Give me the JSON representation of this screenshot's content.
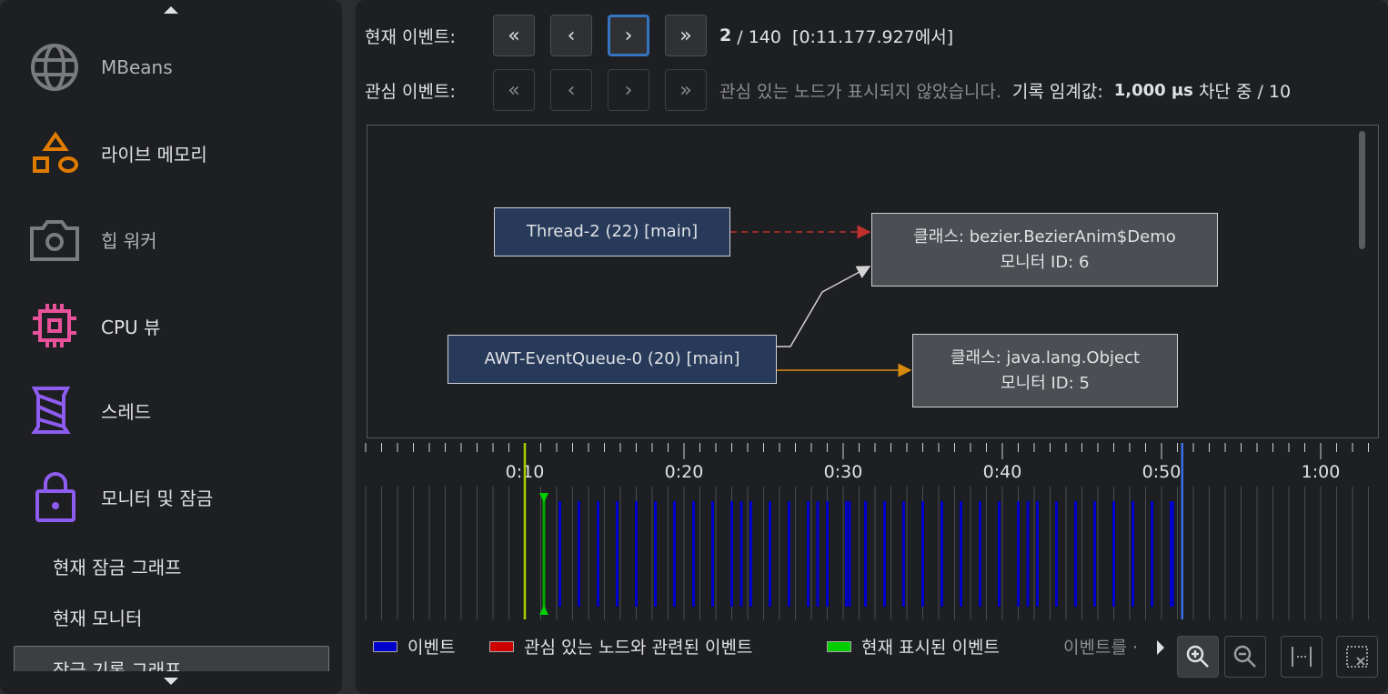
{
  "sidebar": {
    "items": [
      {
        "label": "MBeans",
        "icon": "globe-icon",
        "color": "#7a7b7d"
      },
      {
        "label": "라이브 메모리",
        "icon": "shapes-icon",
        "color": "#e07b00"
      },
      {
        "label": "힙 워커",
        "icon": "camera-icon",
        "color": "#7a7b7d"
      },
      {
        "label": "CPU 뷰",
        "icon": "chip-icon",
        "color": "#e9519a"
      },
      {
        "label": "스레드",
        "icon": "spool-icon",
        "color": "#8e5cf0"
      },
      {
        "label": "모니터 및 잠금",
        "icon": "lock-icon",
        "color": "#8e5cf0"
      }
    ],
    "subitems": [
      "현재 잠금 그래프",
      "현재 모니터",
      "잠금 기록 그래프"
    ]
  },
  "toolbar": {
    "current_label": "현재 이벤트:",
    "current_pos": "2",
    "current_rest": " / 140  [0:11.177.927에서]",
    "interest_label": "관심 이벤트:",
    "interest_msg": "관심 있는 노드가 표시되지 않았습니다.",
    "threshold_label": "기록 임계값:",
    "threshold_value": "1,000 μs",
    "threshold_rest": " 차단 중 / 10",
    "btn_first": "«",
    "btn_prev": "‹",
    "btn_next": "›",
    "btn_last": "»"
  },
  "graph": {
    "threads": [
      "Thread-2 (22) [main]",
      "AWT-EventQueue-0 (20) [main]"
    ],
    "monitors": [
      {
        "class": "클래스: bezier.BezierAnim$Demo",
        "id": "모니터 ID: 6"
      },
      {
        "class": "클래스: java.lang.Object",
        "id": "모니터 ID: 5"
      }
    ],
    "edge_colors": {
      "waiting": "#c0302c",
      "owns": "#d4d4d4",
      "owns2": "#d88a10"
    }
  },
  "timeline": {
    "tick_labels": [
      "0:10",
      "0:20",
      "0:30",
      "0:40",
      "0:50",
      "1:00"
    ],
    "tick_seconds": [
      10,
      20,
      30,
      40,
      50,
      60
    ],
    "range_seconds": [
      0,
      63
    ],
    "cursor_seconds": 10.0,
    "current_event_seconds": 11.2,
    "end_marker_seconds": 51.3,
    "event_seconds": [
      12.2,
      13.4,
      14.6,
      15.8,
      17.0,
      18.2,
      19.4,
      20.6,
      21.8,
      23.0,
      23.6,
      24.2,
      25.4,
      26.6,
      27.8,
      28.4,
      29.0,
      30.2,
      30.4,
      31.4,
      32.6,
      33.8,
      35.0,
      36.2,
      37.4,
      38.6,
      39.8,
      41.0,
      41.6,
      42.2,
      43.4,
      44.6,
      45.8,
      47.0,
      48.2,
      49.4,
      50.6,
      50.7
    ]
  },
  "legend": {
    "items": [
      {
        "label": "이벤트",
        "color": "#0000cc"
      },
      {
        "label": "관심 있는 노드와 관련된 이벤트",
        "color": "#cc0000"
      },
      {
        "label": "현재 표시된 이벤트",
        "color": "#00cc00"
      }
    ],
    "truncated": "이벤트를 ·"
  }
}
